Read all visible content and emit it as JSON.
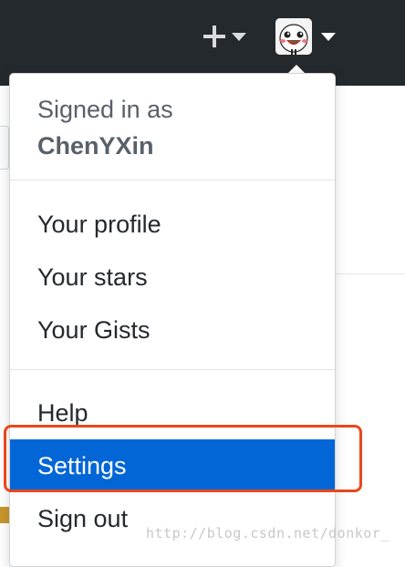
{
  "header": {
    "new_menu_icon": "plus-icon",
    "avatar_icon": "avatar-icon",
    "background_color": "#24292e"
  },
  "dropdown": {
    "signed_in_label": "Signed in as",
    "username": "ChenYXin",
    "items": [
      {
        "label": "Your profile",
        "active": false
      },
      {
        "label": "Your stars",
        "active": false
      },
      {
        "label": "Your Gists",
        "active": false
      },
      {
        "label": "Help",
        "active": false
      },
      {
        "label": "Settings",
        "active": true
      },
      {
        "label": "Sign out",
        "active": false
      }
    ],
    "active_color": "#0366d6"
  },
  "annotation": {
    "highlight_color": "#e8481c"
  },
  "watermark": "http://blog.csdn.net/donkor_"
}
